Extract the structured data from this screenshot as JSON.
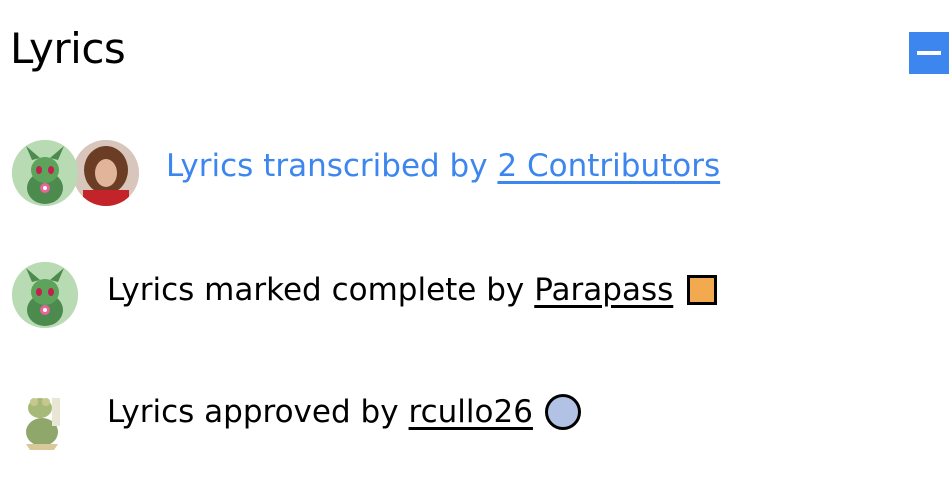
{
  "header": {
    "title": "Lyrics",
    "collapse_icon": "minus-icon"
  },
  "colors": {
    "accent": "#3d86ef",
    "badge_editor": "#f2a94f",
    "badge_moderator": "#b1c2e4"
  },
  "transcribers": {
    "prefix": "Lyrics transcribed by",
    "link_label": "2 Contributors",
    "avatars": [
      "contributor-avatar",
      "contributor-avatar"
    ]
  },
  "completion": {
    "prefix": "Lyrics marked complete by",
    "user": "Parapass",
    "role_icon": "square-badge-icon"
  },
  "approval": {
    "prefix": "Lyrics approved by",
    "user": "rcullo26",
    "role_icon": "circle-badge-icon"
  }
}
